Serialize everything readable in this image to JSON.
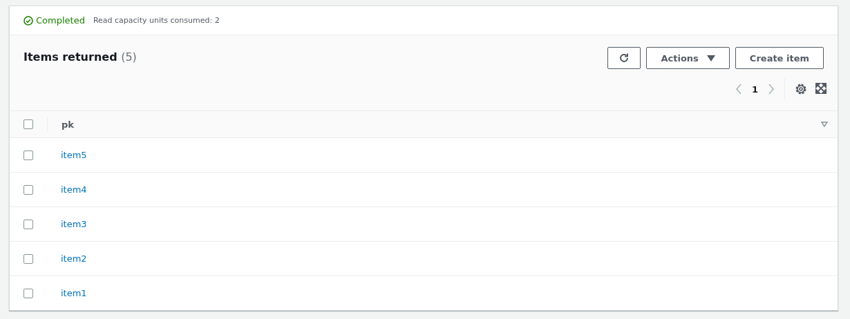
{
  "status": {
    "state": "Completed",
    "detail": "Read capacity units consumed: 2"
  },
  "header": {
    "title": "Items returned",
    "count": "(5)"
  },
  "buttons": [
    {
      "kind": "refresh"
    },
    {
      "kind": "dropdown",
      "label": "Actions"
    },
    {
      "kind": "plain",
      "label": "Create item"
    }
  ],
  "pagination": {
    "prev_disabled": true,
    "next_disabled": true,
    "pages": [
      {
        "label": "1",
        "selected": true
      }
    ]
  },
  "table": {
    "select_all": {
      "checked": false
    },
    "columns": [
      "pk"
    ],
    "rows": [
      {
        "pk": "item5",
        "checked": false
      },
      {
        "pk": "item4",
        "checked": false
      },
      {
        "pk": "item3",
        "checked": false
      },
      {
        "pk": "item2",
        "checked": false
      },
      {
        "pk": "item1",
        "checked": false
      }
    ]
  }
}
